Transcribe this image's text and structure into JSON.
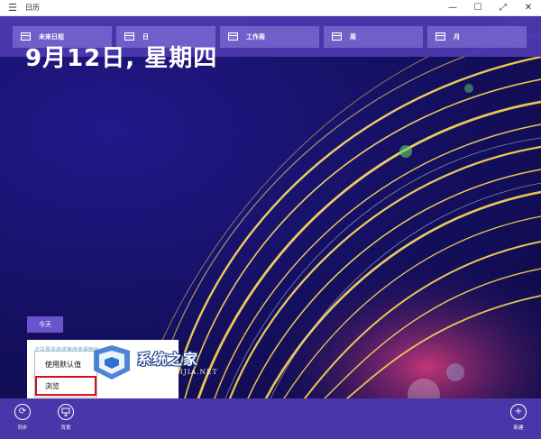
{
  "app": {
    "title": "日历"
  },
  "window_controls": {
    "minimize": "—",
    "maximize": "☐",
    "fullscreen": "⤢",
    "close": "✕"
  },
  "nav": {
    "items": [
      {
        "label": "未来日程",
        "icon": "agenda-icon"
      },
      {
        "label": "日",
        "icon": "day-view-icon"
      },
      {
        "label": "工作周",
        "icon": "work-week-icon"
      },
      {
        "label": "周",
        "icon": "week-icon"
      },
      {
        "label": "月",
        "icon": "month-icon"
      }
    ]
  },
  "main": {
    "date_heading": "9月12日, 星期四",
    "today_label": "今天",
    "panel_hint": "点这里选择或更改背景图片"
  },
  "context_menu": {
    "items": [
      {
        "label": "使用默认值"
      },
      {
        "label": "浏览"
      }
    ]
  },
  "watermark": {
    "text": "系统之家",
    "subtext": "XITONGZHIJIA.NET"
  },
  "appbar": {
    "sync_label": "同步",
    "background_label": "背景",
    "new_label": "新建"
  },
  "colors": {
    "accent": "#4a36a8",
    "nav_bg": "#4e3ab0",
    "nav_button": "#7866ce",
    "highlight": "#d0121b"
  }
}
